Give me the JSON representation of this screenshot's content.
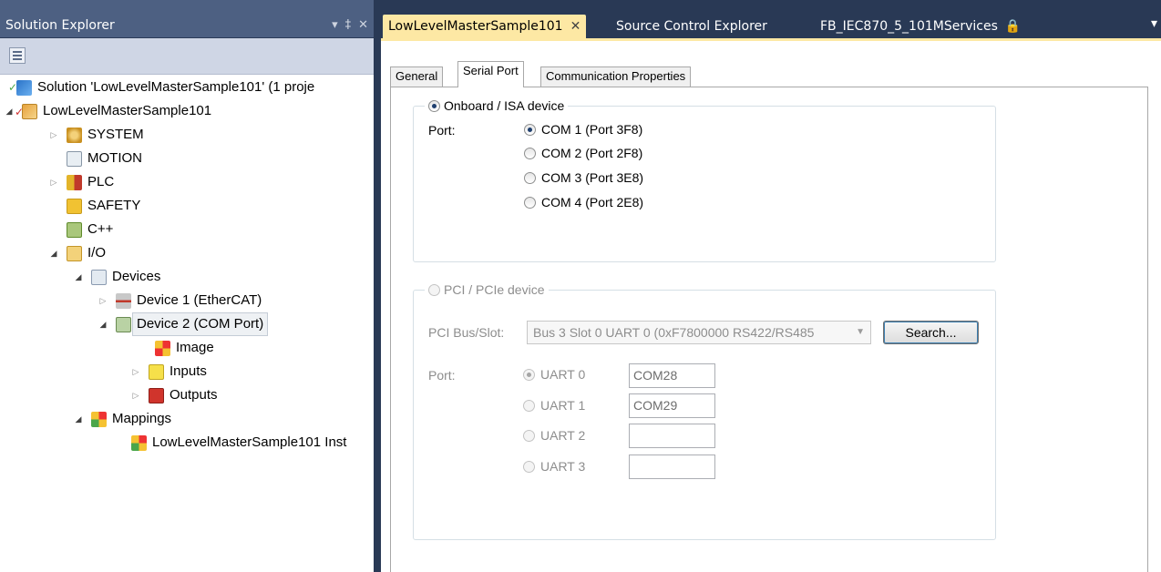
{
  "solution_explorer": {
    "title": "Solution Explorer",
    "controls": [
      "▾",
      "‡",
      "✕"
    ],
    "tree": [
      {
        "label": "Solution 'LowLevelMasterSample101' (1 proje",
        "icon": "solution-icon"
      },
      {
        "label": "LowLevelMasterSample101",
        "icon": "project-icon"
      },
      {
        "label": "SYSTEM",
        "icon": "system-icon"
      },
      {
        "label": "MOTION",
        "icon": "motion-icon"
      },
      {
        "label": "PLC",
        "icon": "plc-icon"
      },
      {
        "label": "SAFETY",
        "icon": "safety-icon"
      },
      {
        "label": "C++",
        "icon": "cpp-icon"
      },
      {
        "label": "I/O",
        "icon": "io-icon"
      },
      {
        "label": "Devices",
        "icon": "devices-icon"
      },
      {
        "label": "Device 1 (EtherCAT)",
        "icon": "ethercat-icon"
      },
      {
        "label": "Device 2 (COM Port)",
        "icon": "com-port-icon"
      },
      {
        "label": "Image",
        "icon": "image-icon"
      },
      {
        "label": "Inputs",
        "icon": "inputs-icon"
      },
      {
        "label": "Outputs",
        "icon": "outputs-icon"
      },
      {
        "label": "Mappings",
        "icon": "mappings-icon"
      },
      {
        "label": "LowLevelMasterSample101 Inst",
        "icon": "mapping-instance-icon"
      }
    ]
  },
  "doc_tabs": {
    "tab1": "LowLevelMasterSample101",
    "tab2": "Source Control Explorer",
    "tab3": "FB_IEC870_5_101MServices",
    "overflow": "▾"
  },
  "inner_tabs": {
    "general": "General",
    "serial_port": "Serial Port",
    "comm_props": "Communication Properties"
  },
  "onboard": {
    "title": "Onboard / ISA device",
    "port_label": "Port:",
    "options": [
      "COM 1 (Port 3F8)",
      "COM 2 (Port 2F8)",
      "COM 3 (Port 3E8)",
      "COM 4 (Port 2E8)"
    ],
    "selected": "COM 1 (Port 3F8)"
  },
  "pci": {
    "title": "PCI / PCIe device",
    "bus_slot_label": "PCI Bus/Slot:",
    "bus_slot_value": "Bus 3 Slot 0 UART 0 (0xF7800000 RS422/RS485",
    "search_button": "Search...",
    "port_label": "Port:",
    "uarts": [
      {
        "label": "UART 0",
        "value": "COM28"
      },
      {
        "label": "UART 1",
        "value": "COM29"
      },
      {
        "label": "UART 2",
        "value": ""
      },
      {
        "label": "UART 3",
        "value": ""
      }
    ],
    "selected": "UART 0"
  },
  "colors": {
    "chrome_dark": "#293955",
    "panel_title": "#4d6082",
    "active_tab": "#fde8a4"
  }
}
